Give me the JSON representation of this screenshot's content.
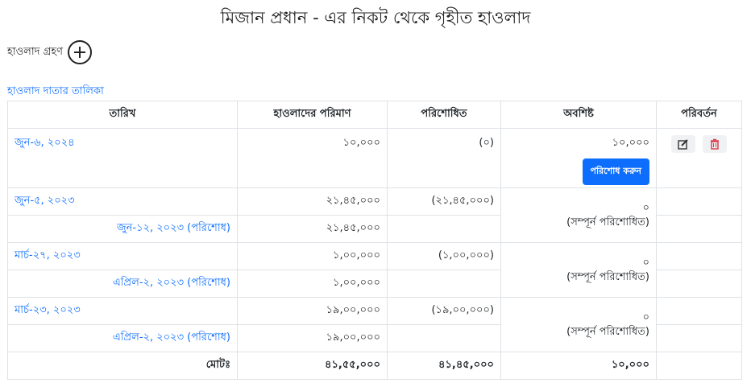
{
  "page": {
    "title": "মিজান প্রধান - এর নিকট থেকে গৃহীত হাওলাদ",
    "add_label": "হাওলাদ গ্রহণ",
    "list_link": "হাওলাদ দাতার তালিকা"
  },
  "table": {
    "headers": [
      "তারিখ",
      "হাওলাদের পরিমাণ",
      "পরিশোধিত",
      "অবশিষ্ট",
      "পরিবর্তন"
    ],
    "loans": [
      {
        "date": "জুন-৬, ২০২৪",
        "amount": "১০,০০০",
        "paid": "(০)",
        "remaining": "১০,০০০",
        "pay_button": "পরিশোধ করুন",
        "payments": []
      },
      {
        "date": "জুন-৫, ২০২৩",
        "amount": "২১,৪৫,০০০",
        "paid": "(২১,৪৫,০০০)",
        "remaining": "০",
        "status": "(সম্পূর্ন পরিশোধিত)",
        "payments": [
          {
            "date": "জুন-১২, ২০২৩ (পরিশোধ)",
            "amount": "২১,৪৫,০০০"
          }
        ]
      },
      {
        "date": "মার্চ-২৭, ২০২৩",
        "amount": "১,০০,০০০",
        "paid": "(১,০০,০০০)",
        "remaining": "০",
        "status": "(সম্পূর্ন পরিশোধিত)",
        "payments": [
          {
            "date": "এপ্রিল-২, ২০২৩ (পরিশোধ)",
            "amount": "১,০০,০০০"
          }
        ]
      },
      {
        "date": "মার্চ-২৩, ২০২৩",
        "amount": "১৯,০০,০০০",
        "paid": "(১৯,০০,০০০)",
        "remaining": "০",
        "status": "(সম্পূর্ন পরিশোধিত)",
        "payments": [
          {
            "date": "এপ্রিল-২, ২০২৩ (পরিশোধ)",
            "amount": "১৯,০০,০০০"
          }
        ]
      }
    ],
    "total": {
      "label": "মোটঃ",
      "amount": "৪১,৫৫,০০০",
      "paid": "৪১,৪৫,০০০",
      "remaining": "১০,০০০"
    }
  },
  "icons": {
    "add": "plus-circle-icon",
    "edit": "edit-icon",
    "delete": "trash-icon"
  },
  "colors": {
    "link": "#0d6efd",
    "button": "#0d6efd",
    "delete": "#dc3545"
  }
}
